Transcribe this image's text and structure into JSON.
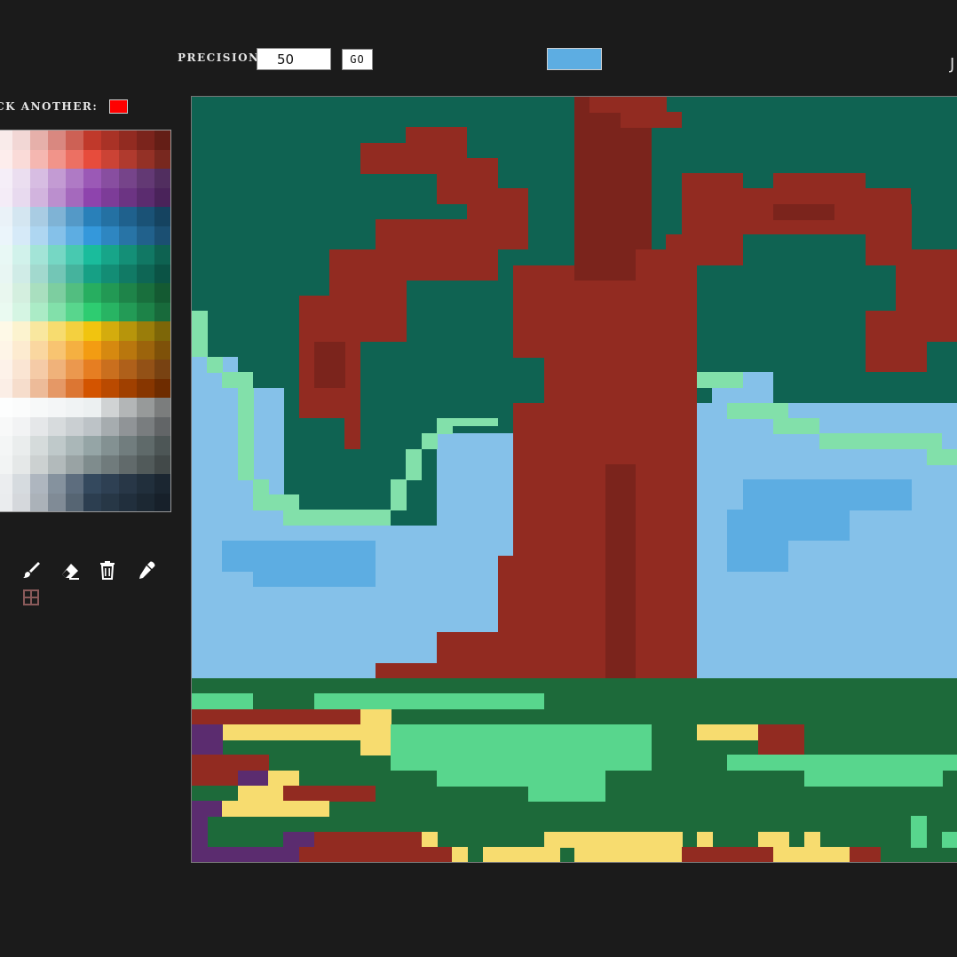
{
  "toolbar": {
    "precision_label": "PRECISION",
    "precision_value": "50",
    "go_label": "GO",
    "current_color": "#5dade2"
  },
  "corner_glyph": "J",
  "picker": {
    "pick_label": "ICK ANOTHER:",
    "pick_color": "#ff0000"
  },
  "palette": [
    [
      "#f9ebea",
      "#f2d7d5",
      "#e6b0aa",
      "#d98880",
      "#cd6155",
      "#c0392b",
      "#a93226",
      "#922b21",
      "#7b241c",
      "#641e16"
    ],
    [
      "#fdedec",
      "#fadbd8",
      "#f5b7b1",
      "#f1948a",
      "#ec7063",
      "#e74c3c",
      "#cb4335",
      "#b03a2e",
      "#943126",
      "#78281f"
    ],
    [
      "#f5eef8",
      "#ebdef0",
      "#d7bde2",
      "#c39bd3",
      "#af7ac5",
      "#9b59b6",
      "#884ea0",
      "#76448a",
      "#633974",
      "#512e5f"
    ],
    [
      "#f4ecf7",
      "#e8daef",
      "#d2b4de",
      "#bb8fce",
      "#a569bd",
      "#8e44ad",
      "#7d3c98",
      "#6c3483",
      "#5b2c6f",
      "#4a235a"
    ],
    [
      "#eaf2f8",
      "#d4e6f1",
      "#a9cce3",
      "#7fb3d5",
      "#5499c7",
      "#2980b9",
      "#2471a3",
      "#1f618d",
      "#1a5276",
      "#154360"
    ],
    [
      "#ebf5fb",
      "#d6eaf8",
      "#aed6f1",
      "#85c1e9",
      "#5dade2",
      "#3498db",
      "#2e86c1",
      "#2874a6",
      "#21618c",
      "#1b4f72"
    ],
    [
      "#e8f8f5",
      "#d1f2eb",
      "#a3e4d7",
      "#76d7c4",
      "#48c9b0",
      "#1abc9c",
      "#17a589",
      "#148f77",
      "#117864",
      "#0e6251"
    ],
    [
      "#e8f6f3",
      "#d0ece7",
      "#a2d9ce",
      "#73c6b6",
      "#45b39d",
      "#16a085",
      "#138d75",
      "#117a65",
      "#0e6655",
      "#0b5345"
    ],
    [
      "#e9f7ef",
      "#d4efdf",
      "#a9dfbf",
      "#7dcea0",
      "#52be80",
      "#27ae60",
      "#229954",
      "#1e8449",
      "#196f3d",
      "#145a32"
    ],
    [
      "#eafaf1",
      "#d5f5e3",
      "#abebc6",
      "#82e0aa",
      "#58d68d",
      "#2ecc71",
      "#28b463",
      "#239b56",
      "#1d8348",
      "#186a3b"
    ],
    [
      "#fef9e7",
      "#fcf3cf",
      "#f9e79f",
      "#f7dc6f",
      "#f4d03f",
      "#f1c40f",
      "#d4ac0d",
      "#b7950b",
      "#9a7d0a",
      "#7d6608"
    ],
    [
      "#fef5e7",
      "#fdebd0",
      "#fad7a0",
      "#f8c471",
      "#f5b041",
      "#f39c12",
      "#d68910",
      "#b9770e",
      "#9c640c",
      "#7e5109"
    ],
    [
      "#fdf2e9",
      "#fae5d3",
      "#f5cba7",
      "#f0b27a",
      "#eb984e",
      "#e67e22",
      "#ca6f1e",
      "#af601a",
      "#935116",
      "#784212"
    ],
    [
      "#fbeee6",
      "#f6ddcc",
      "#edbb99",
      "#e59866",
      "#dc7633",
      "#d35400",
      "#ba4a00",
      "#a04000",
      "#873600",
      "#6e2c00"
    ],
    [
      "#fdfefe",
      "#fbfcfc",
      "#f7f9f9",
      "#f4f6f7",
      "#f0f3f4",
      "#ecf0f1",
      "#d0d3d4",
      "#b3b6b7",
      "#979a9a",
      "#7b7d7d"
    ],
    [
      "#f8f9f9",
      "#f2f3f4",
      "#e5e7e9",
      "#d7dbdd",
      "#cacfd2",
      "#bdc3c7",
      "#a6acaf",
      "#909497",
      "#797d7f",
      "#626567"
    ],
    [
      "#f4f6f6",
      "#eaeded",
      "#d5dbdb",
      "#bfc9ca",
      "#aab7b8",
      "#95a5a6",
      "#839192",
      "#717d7e",
      "#5f6a6a",
      "#4d5656"
    ],
    [
      "#f2f4f4",
      "#e5e8e8",
      "#ccd1d1",
      "#b2babb",
      "#99a3a4",
      "#7f8c8d",
      "#707b7c",
      "#616a6b",
      "#515a5a",
      "#424949"
    ],
    [
      "#ebedef",
      "#d6dbdf",
      "#aeb6bf",
      "#85929e",
      "#5d6d7e",
      "#34495e",
      "#2e4053",
      "#283747",
      "#212f3c",
      "#1b2631"
    ],
    [
      "#eaecee",
      "#d5d8dc",
      "#abb2b9",
      "#808b96",
      "#566573",
      "#2c3e50",
      "#273746",
      "#212f3d",
      "#1c2833",
      "#17202a"
    ]
  ],
  "tools": {
    "brush_color": "#ffffff",
    "grid_color": "#8a5a5a"
  },
  "canvas_colors": {
    "teal": "#0f6352",
    "red": "#922b21",
    "dark_red": "#7b241c",
    "mint": "#82e0aa",
    "sky": "#85c1e9",
    "blue": "#5dade2",
    "forest": "#1d6a3a",
    "grass": "#58d68d",
    "yellow": "#f7dc6f",
    "purple": "#5b2c6f"
  }
}
